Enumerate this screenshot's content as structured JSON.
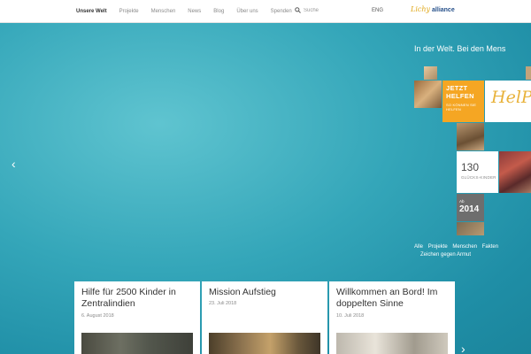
{
  "nav": {
    "items": [
      {
        "label": "Unsere Welt",
        "active": true
      },
      {
        "label": "Projekte"
      },
      {
        "label": "Menschen"
      },
      {
        "label": "News"
      },
      {
        "label": "Blog"
      },
      {
        "label": "Über uns"
      },
      {
        "label": "Spenden"
      }
    ],
    "search_placeholder": "Suche",
    "lang": "ENG",
    "logo_script": "Lichy",
    "logo_word": "alliance"
  },
  "hero": {
    "tagline": "In der Welt. Bei den Mens",
    "help_cta_title": "JETZT HELFEN",
    "help_cta_sub": "SO KÖNNEN SIE HELFEN",
    "help_word": "HelP",
    "kids_count": "130",
    "kids_label": "GLÜCKS-KINDER",
    "since_label": "Ab",
    "since_year": "2014",
    "filters": [
      "Alle",
      "Projekte",
      "Menschen",
      "Fakten",
      "Zeichen gegen Armut"
    ]
  },
  "cards": [
    {
      "title": "Hilfe für 2500 Kinder in Zentralindien",
      "date": "6. August 2018"
    },
    {
      "title": "Mission Aufstieg",
      "date": "23. Juli 2018"
    },
    {
      "title": "Willkommen an Bord! Im doppelten Sinne",
      "date": "10. Juli 2018"
    }
  ],
  "colors": {
    "accent": "#f5a623",
    "hero_bg": "#34a6b9",
    "logo_blue": "#26508a"
  }
}
